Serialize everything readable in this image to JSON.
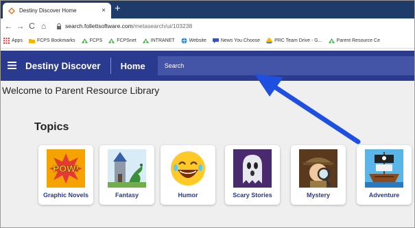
{
  "browser": {
    "tab_title": "Destiny Discover Home",
    "tab_close": "×",
    "new_tab": "+",
    "url_host": "search.follettsoftware.com",
    "url_path": "/metasearch/ui/103238",
    "nav": {
      "back": "←",
      "forward": "→",
      "reload": "C",
      "home": "⌂"
    }
  },
  "bookmarks": [
    {
      "label": "Apps",
      "icon": "apps-grid-icon",
      "color": "#e53935"
    },
    {
      "label": "FCPS Bookmarks",
      "icon": "folder-icon",
      "color": "#f4b400"
    },
    {
      "label": "FCPS",
      "icon": "fcps-icon",
      "color": "#4caf50"
    },
    {
      "label": "FCPSnet",
      "icon": "fcps-icon",
      "color": "#4caf50"
    },
    {
      "label": "INTRANET",
      "icon": "fcps-icon",
      "color": "#4caf50"
    },
    {
      "label": "Website",
      "icon": "globe-icon",
      "color": "#1e88e5"
    },
    {
      "label": "News You Choose",
      "icon": "chat-icon",
      "color": "#3f51b5"
    },
    {
      "label": "PRC Team Drive - G...",
      "icon": "drive-icon",
      "color": "#fbbc05"
    },
    {
      "label": "Parent Resource Ce",
      "icon": "fcps-icon",
      "color": "#4caf50"
    }
  ],
  "app": {
    "brand": "Destiny Discover",
    "home": "Home",
    "search_placeholder": "Search",
    "accent": "#2a3a8f"
  },
  "page": {
    "welcome": "Welcome to Parent Resource Library",
    "topics_heading": "Topics"
  },
  "topics": [
    {
      "label": "Graphic Novels",
      "icon": "pow-comic-icon"
    },
    {
      "label": "Fantasy",
      "icon": "castle-dragon-icon"
    },
    {
      "label": "Humor",
      "icon": "laughing-emoji-icon"
    },
    {
      "label": "Scary Stories",
      "icon": "ghost-icon"
    },
    {
      "label": "Mystery",
      "icon": "detective-icon"
    },
    {
      "label": "Adventure",
      "icon": "pirate-ship-icon"
    }
  ]
}
